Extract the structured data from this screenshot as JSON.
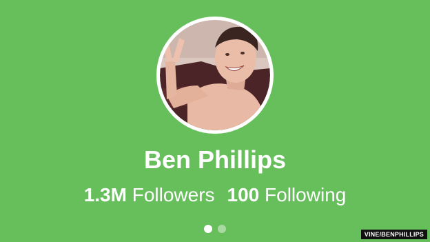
{
  "profile": {
    "name": "Ben Phillips",
    "followers_count": "1.3M",
    "followers_label": "Followers",
    "following_count": "100",
    "following_label": "Following",
    "avatar_icon": "profile-photo"
  },
  "pager": {
    "total": 2,
    "active_index": 0
  },
  "credit": "VINE/BENPHILLIPS",
  "colors": {
    "background": "#67bf5c",
    "text": "#ffffff",
    "dot_active": "#ffffff",
    "dot_inactive": "#a9daa2"
  }
}
